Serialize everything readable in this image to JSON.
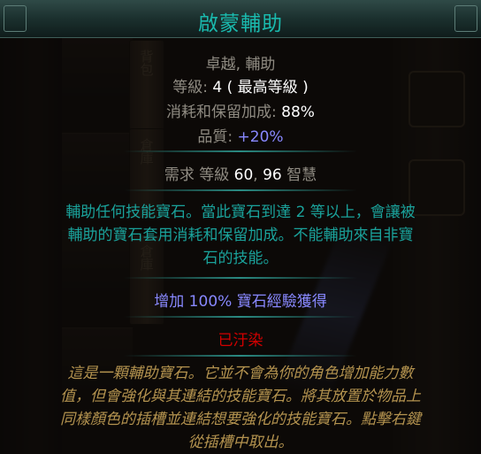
{
  "item": {
    "name": "啟蒙輔助",
    "tags": "卓越, 輔助",
    "level_label": "等級: ",
    "level_value": "4 ( 最高等級 )",
    "cost_label": "消耗和保留加成: ",
    "cost_value": "88%",
    "quality_label": "品質: ",
    "quality_value": "+20%",
    "req_prefix": "需求 等級 ",
    "req_level": "60",
    "req_sep": ", ",
    "req_int": "96",
    "req_int_label": " 智慧",
    "description": [
      "輔助任何技能寶石。當此寶石到達 2 等以上，會讓被",
      "輔助的寶石套用消耗和保留加成。不能輔助來自非寶",
      "石的技能。"
    ],
    "bonus": "增加 100% 寶石經驗獲得",
    "corrupted": "已汙染",
    "flavor": [
      "這是一顆輔助寶石。它並不會為你的角色增加能力數",
      "值，但會強化與其連結的技能寶石。將其放置於物品上",
      "同樣顏色的插槽並連結想要強化的技能寶石。點擊右鍵",
      "從插槽中取出。"
    ]
  },
  "background": {
    "tab_labels": [
      "背包",
      "倉庫",
      "倉庫"
    ]
  },
  "colors": {
    "name": "#1ab9ad",
    "property_label": "#8f8b82",
    "value": "#ffffff",
    "augmented": "#8888ff",
    "description": "#1aa29b",
    "corrupted": "#d20000",
    "flavor": "#b4934f"
  }
}
